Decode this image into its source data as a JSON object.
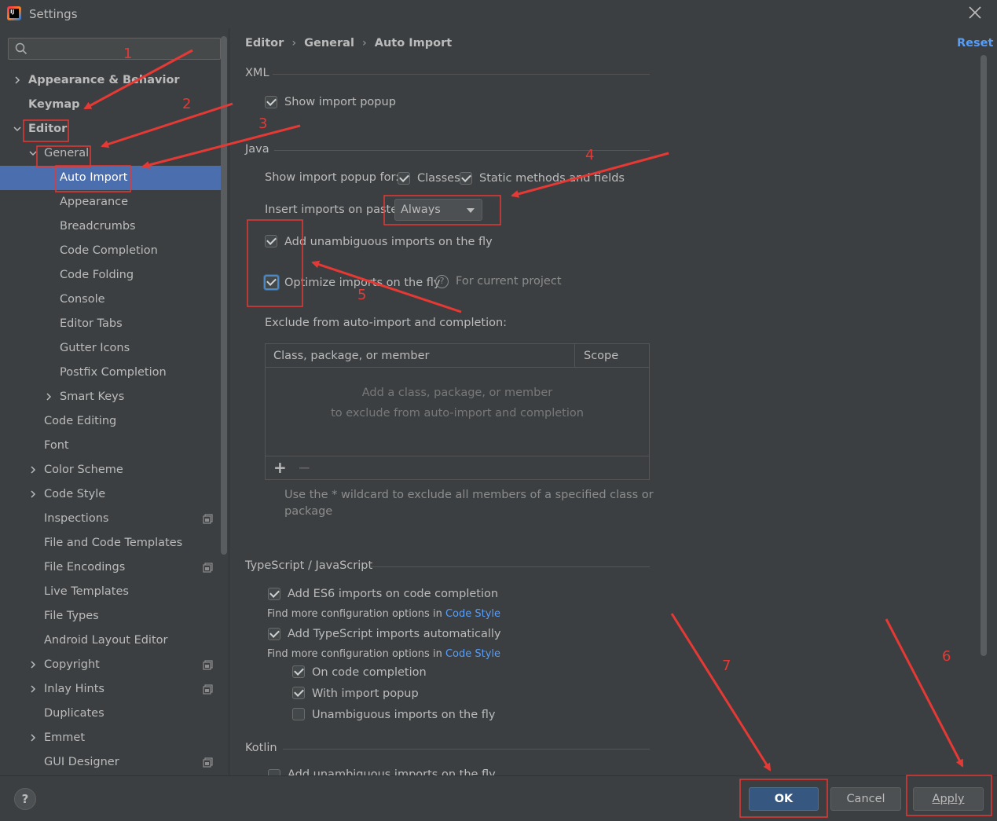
{
  "window": {
    "title": "Settings"
  },
  "search": {
    "placeholder": ""
  },
  "sidebar": {
    "items": [
      {
        "label": "Appearance & Behavior",
        "level": 0,
        "expandable": true,
        "expanded": false,
        "bold": true
      },
      {
        "label": "Keymap",
        "level": 0,
        "expandable": false,
        "bold": true
      },
      {
        "label": "Editor",
        "level": 0,
        "expandable": true,
        "expanded": true,
        "bold": true
      },
      {
        "label": "General",
        "level": 1,
        "expandable": true,
        "expanded": true
      },
      {
        "label": "Auto Import",
        "level": 2,
        "selected": true
      },
      {
        "label": "Appearance",
        "level": 2
      },
      {
        "label": "Breadcrumbs",
        "level": 2
      },
      {
        "label": "Code Completion",
        "level": 2
      },
      {
        "label": "Code Folding",
        "level": 2
      },
      {
        "label": "Console",
        "level": 2
      },
      {
        "label": "Editor Tabs",
        "level": 2
      },
      {
        "label": "Gutter Icons",
        "level": 2
      },
      {
        "label": "Postfix Completion",
        "level": 2
      },
      {
        "label": "Smart Keys",
        "level": 2,
        "expandable": true,
        "expanded": false
      },
      {
        "label": "Code Editing",
        "level": 1
      },
      {
        "label": "Font",
        "level": 1
      },
      {
        "label": "Color Scheme",
        "level": 1,
        "expandable": true,
        "expanded": false
      },
      {
        "label": "Code Style",
        "level": 1,
        "expandable": true,
        "expanded": false
      },
      {
        "label": "Inspections",
        "level": 1,
        "project_icon": true
      },
      {
        "label": "File and Code Templates",
        "level": 1
      },
      {
        "label": "File Encodings",
        "level": 1,
        "project_icon": true
      },
      {
        "label": "Live Templates",
        "level": 1
      },
      {
        "label": "File Types",
        "level": 1
      },
      {
        "label": "Android Layout Editor",
        "level": 1
      },
      {
        "label": "Copyright",
        "level": 1,
        "expandable": true,
        "expanded": false,
        "project_icon": true
      },
      {
        "label": "Inlay Hints",
        "level": 1,
        "expandable": true,
        "expanded": false,
        "project_icon": true
      },
      {
        "label": "Duplicates",
        "level": 1
      },
      {
        "label": "Emmet",
        "level": 1,
        "expandable": true,
        "expanded": false
      },
      {
        "label": "GUI Designer",
        "level": 1,
        "project_icon": true
      }
    ]
  },
  "breadcrumb": {
    "items": [
      "Editor",
      "General",
      "Auto Import"
    ],
    "separator": "›"
  },
  "reset_label": "Reset",
  "xml": {
    "title": "XML",
    "show_import_popup": {
      "label": "Show import popup",
      "checked": true
    }
  },
  "java": {
    "title": "Java",
    "show_popup_for_label": "Show import popup for:",
    "classes": {
      "label": "Classes",
      "checked": true
    },
    "static_methods": {
      "label": "Static methods and fields",
      "checked": true
    },
    "insert_on_paste_label": "Insert imports on paste:",
    "insert_on_paste_value": "Always",
    "add_unambiguous": {
      "label": "Add unambiguous imports on the fly",
      "checked": true
    },
    "optimize_imports": {
      "label": "Optimize imports on the fly",
      "checked": true
    },
    "for_current_project": "For current project",
    "exclude_label": "Exclude from auto-import and completion:",
    "table": {
      "col_name": "Class, package, or member",
      "col_scope": "Scope",
      "empty_line1": "Add a class, package, or member",
      "empty_line2": "to exclude from auto-import and completion",
      "add": "+",
      "remove": "−"
    },
    "hint_line1": "Use the * wildcard to exclude all members of a specified class or",
    "hint_line2": "package"
  },
  "typescript": {
    "title": "TypeScript / JavaScript",
    "es6": {
      "label": "Add ES6 imports on code completion",
      "checked": true
    },
    "find_more_1": "Find more configuration options in",
    "code_style_1": "Code Style",
    "ts_auto": {
      "label": "Add TypeScript imports automatically",
      "checked": true
    },
    "find_more_2": "Find more configuration options in",
    "code_style_2": "Code Style",
    "on_completion": {
      "label": "On code completion",
      "checked": true
    },
    "with_popup": {
      "label": "With import popup",
      "checked": true
    },
    "unambiguous": {
      "label": "Unambiguous imports on the fly",
      "checked": false
    }
  },
  "kotlin": {
    "title": "Kotlin",
    "add_unambiguous_label": "Add unambiguous imports on the fly"
  },
  "footer": {
    "help": "?",
    "ok": "OK",
    "cancel": "Cancel",
    "apply": "Apply"
  },
  "annotations": {
    "color": "#e53935",
    "labels": [
      "1",
      "2",
      "3",
      "4",
      "5",
      "6",
      "7"
    ]
  },
  "colors": {
    "background": "#3c3f41",
    "selection": "#4b6eaf",
    "link": "#589df6",
    "primary_button": "#365880"
  }
}
